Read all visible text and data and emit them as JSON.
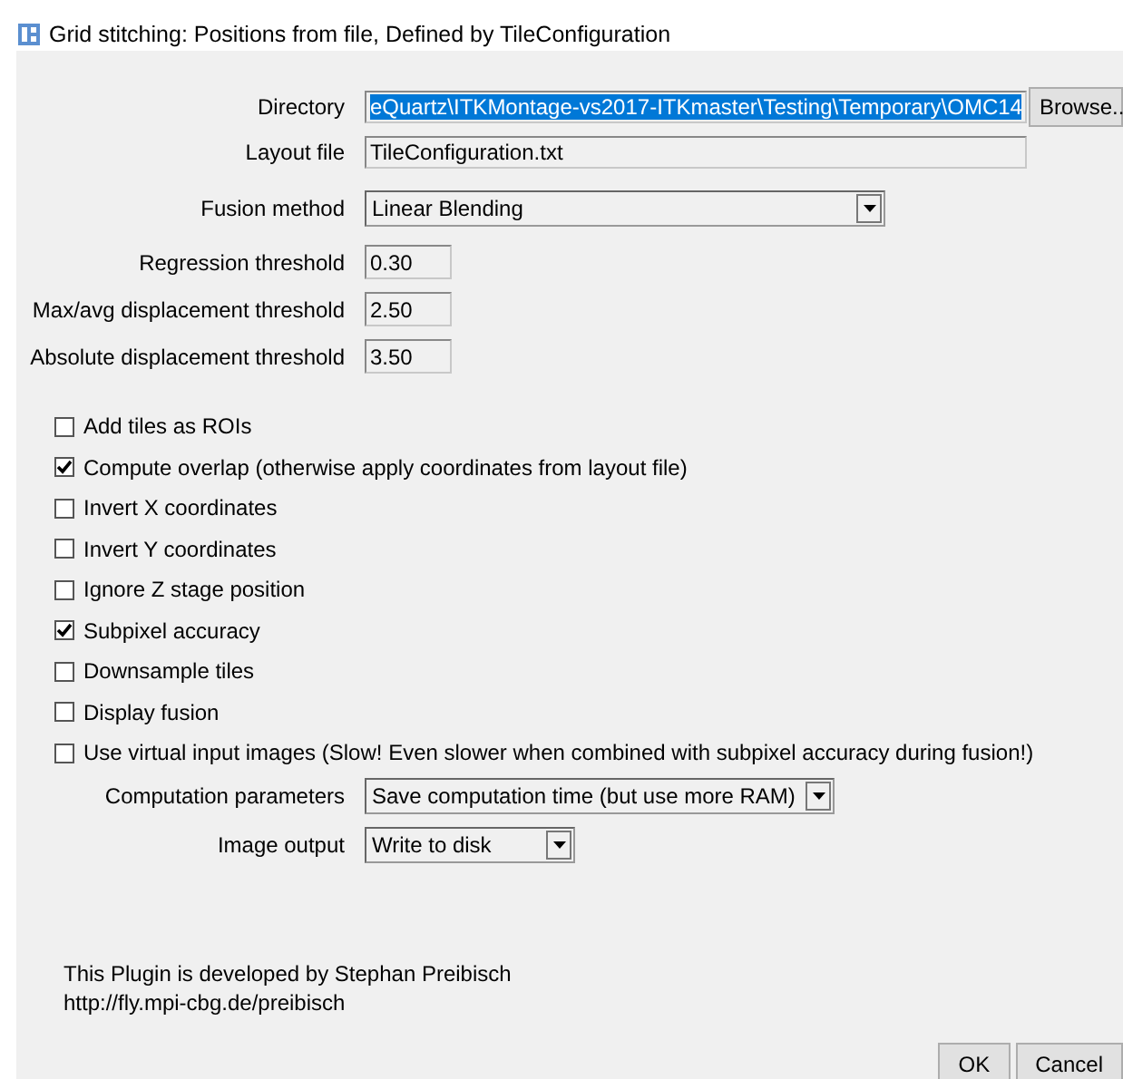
{
  "window": {
    "title": "Grid stitching: Positions from file, Defined by TileConfiguration"
  },
  "top_fields": [
    {
      "kind": "path",
      "label": "Directory",
      "value": "eQuartz\\ITKMontage-vs2017-ITKmaster\\Testing\\Temporary\\OMC14",
      "highlighted": true,
      "button": "Browse.."
    },
    {
      "kind": "text",
      "label": "Layout file",
      "value": "TileConfiguration.txt",
      "highlighted": false
    },
    {
      "kind": "dropdown",
      "label": "Fusion method",
      "value": "Linear Blending"
    }
  ],
  "thresholds": [
    {
      "label": "Regression threshold",
      "value": "0.30"
    },
    {
      "label": "Max/avg displacement threshold",
      "value": "2.50"
    },
    {
      "label": "Absolute displacement threshold",
      "value": "3.50"
    }
  ],
  "options": [
    {
      "label": "Add tiles as ROIs",
      "checked": false
    },
    {
      "label": "Compute overlap (otherwise apply coordinates from layout file)",
      "checked": true
    },
    {
      "label": "Invert X coordinates",
      "checked": false
    },
    {
      "label": "Invert Y coordinates",
      "checked": false
    },
    {
      "label": "Ignore Z stage position",
      "checked": false
    },
    {
      "label": "Subpixel accuracy",
      "checked": true
    },
    {
      "label": "Downsample tiles",
      "checked": false
    },
    {
      "label": "Display fusion",
      "checked": false
    },
    {
      "label": "Use virtual input images (Slow! Even slower when combined with subpixel accuracy during fusion!)",
      "checked": false
    }
  ],
  "dropdowns": [
    {
      "label": "Computation parameters",
      "value": "Save computation time (but use more RAM)"
    },
    {
      "label": "Image output",
      "value": "Write to disk"
    }
  ],
  "credits": [
    "This Plugin is developed by Stephan Preibisch",
    "http://fly.mpi-cbg.de/preibisch"
  ],
  "buttons": [
    "OK",
    "Cancel"
  ]
}
